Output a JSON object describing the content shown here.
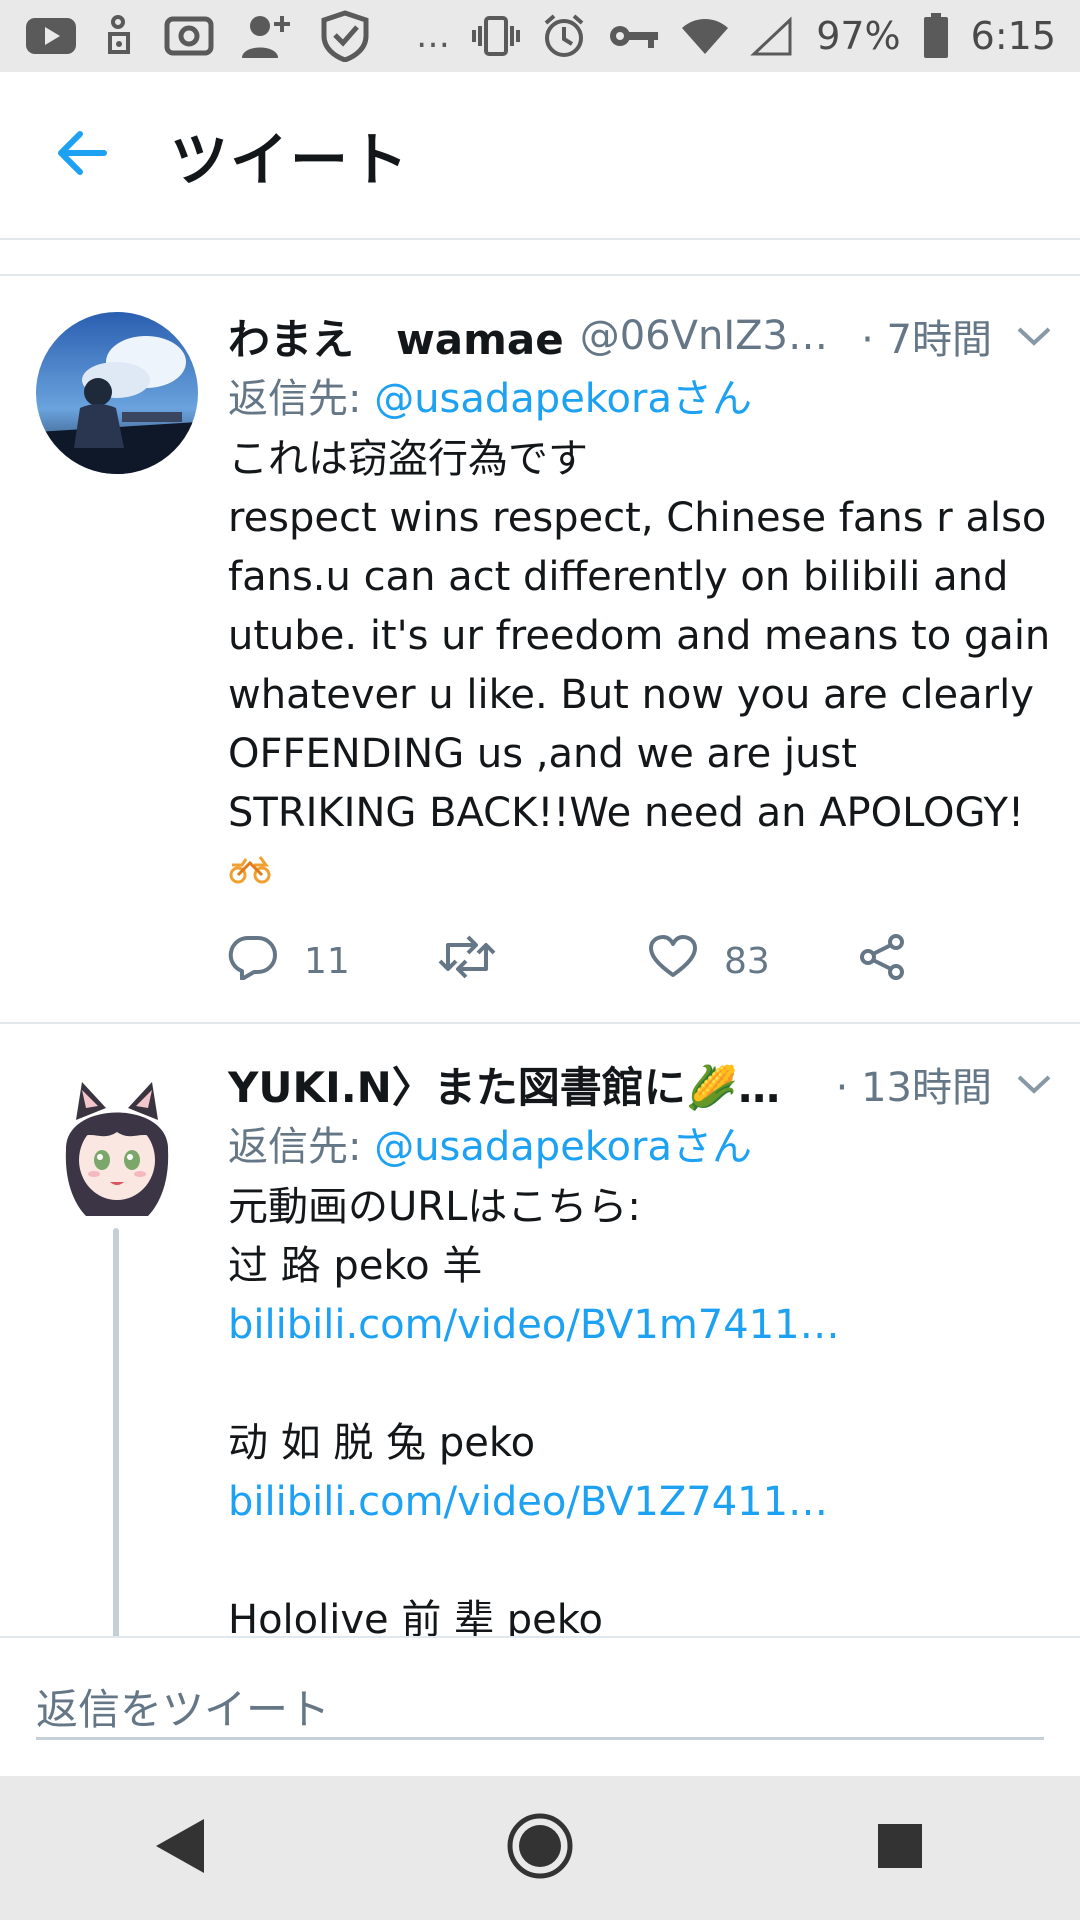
{
  "status_bar": {
    "battery": "97%",
    "time": "6:15",
    "overflow": "…",
    "icons": [
      "youtube-icon",
      "media-icon",
      "cast-icon",
      "add-person-icon",
      "shield-icon",
      "vibrate-icon",
      "alarm-icon",
      "key-icon",
      "wifi-icon",
      "signal-icon",
      "battery-icon"
    ]
  },
  "header": {
    "title": "ツイート"
  },
  "tweets": [
    {
      "display_name": "わまえ　wamae",
      "handle": "@06VnIZ3…",
      "time": "· 7時間",
      "reply_label": "返信先: ",
      "reply_to": "@usadapekoraさん",
      "lines": [
        "これは窃盗行為です",
        "respect wins respect, Chinese fans r also",
        "fans.u can act differently on bilibili and",
        "utube. it's ur freedom and means to gain",
        "whatever u like. But now you are clearly",
        "OFFENDING us ,and we are just",
        "STRIKING BACK!!We need an APOLOGY!"
      ],
      "replies": "11",
      "likes": "83"
    },
    {
      "display_name": "YUKI.N〉また図書館に🌽…",
      "time": "· 13時間",
      "reply_label": "返信先: ",
      "reply_to": "@usadapekoraさん",
      "line1": "元動画のURLはこちら:",
      "line2": "过 路 peko 羊",
      "link1": "bilibili.com/video/BV1m7411…",
      "line3": "动 如 脱 兔 peko",
      "link2": "bilibili.com/video/BV1Z7411…",
      "line4": "Hololive 前 辈 peko"
    }
  ],
  "composer": {
    "placeholder": "返信をツイート"
  }
}
